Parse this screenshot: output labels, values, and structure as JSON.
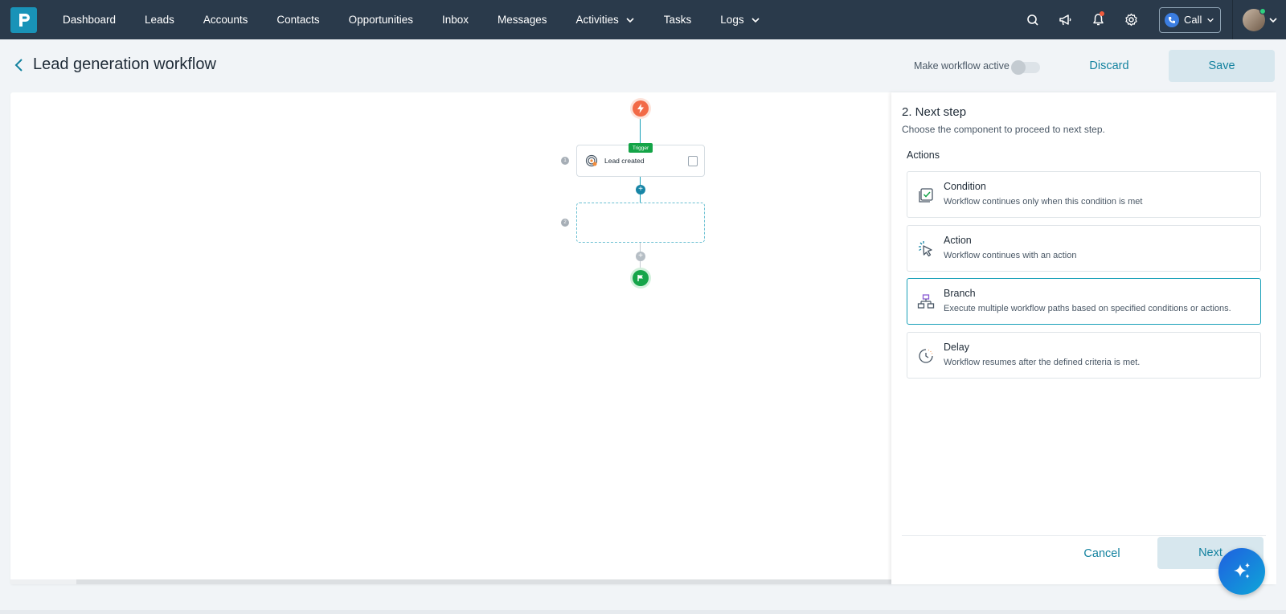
{
  "nav": {
    "logo_icon": "pipeline-logo-icon",
    "items": [
      {
        "label": "Dashboard"
      },
      {
        "label": "Leads"
      },
      {
        "label": "Accounts"
      },
      {
        "label": "Contacts"
      },
      {
        "label": "Opportunities"
      },
      {
        "label": "Inbox"
      },
      {
        "label": "Messages"
      },
      {
        "label": "Activities",
        "has_dropdown": true
      },
      {
        "label": "Tasks"
      },
      {
        "label": "Logs",
        "has_dropdown": true
      }
    ],
    "right_icons": [
      "search-icon",
      "megaphone-icon",
      "bell-icon",
      "gear-icon"
    ],
    "call_label": "Call",
    "colors": {
      "bar": "#2a3a4b",
      "accent": "#1993b8",
      "notification": "#f05a3c"
    }
  },
  "header": {
    "title": "Lead generation workflow",
    "active_toggle_label": "Make workflow active",
    "active": false,
    "discard_label": "Discard",
    "save_label": "Save"
  },
  "canvas": {
    "trigger_tag": "Trigger",
    "nodes": [
      {
        "step": "1",
        "label": "Lead created"
      },
      {
        "step": "2",
        "label": ""
      }
    ]
  },
  "panel": {
    "title": "2. Next step",
    "subtitle": "Choose the component to proceed to next step.",
    "section": "Actions",
    "options": [
      {
        "title": "Condition",
        "desc": "Workflow continues only when this condition is met",
        "icon": "condition-check-icon",
        "selected": false
      },
      {
        "title": "Action",
        "desc": "Workflow continues with an action",
        "icon": "cursor-click-icon",
        "selected": false
      },
      {
        "title": "Branch",
        "desc": "Execute multiple workflow paths based on specified conditions or actions.",
        "icon": "branch-icon",
        "selected": true
      },
      {
        "title": "Delay",
        "desc": "Workflow resumes after the defined criteria is met.",
        "icon": "clock-delay-icon",
        "selected": false
      }
    ],
    "cancel_label": "Cancel",
    "next_label": "Next"
  }
}
